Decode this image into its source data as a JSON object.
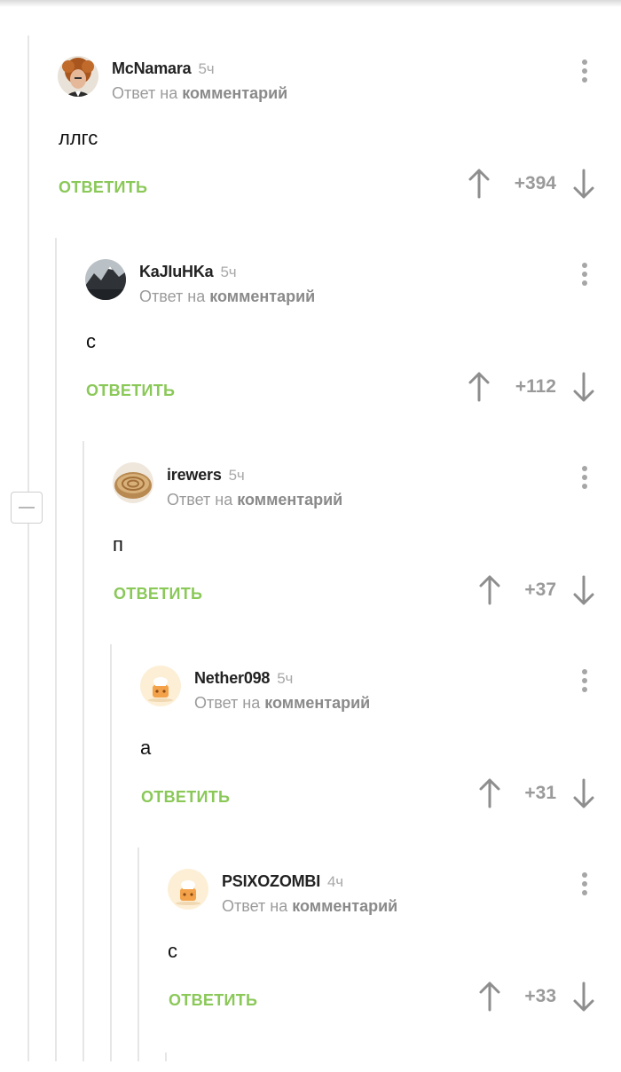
{
  "comments": [
    {
      "author": "McNamara",
      "time": "5ч",
      "reply_prefix": "Ответ на",
      "reply_link": "комментарий",
      "body": "ллгс",
      "reply_label": "ОТВЕТИТЬ",
      "score": "+394",
      "avatar_icon": "curly-hair-man-avatar"
    },
    {
      "author": "KaJIuHKa",
      "time": "5ч",
      "reply_prefix": "Ответ на",
      "reply_link": "комментарий",
      "body": "с",
      "reply_label": "ОТВЕТИТЬ",
      "score": "+112",
      "avatar_icon": "mountain-landscape-avatar"
    },
    {
      "author": "irewers",
      "time": "5ч",
      "reply_prefix": "Ответ на",
      "reply_link": "комментарий",
      "body": "п",
      "reply_label": "ОТВЕТИТЬ",
      "score": "+37",
      "avatar_icon": "pie-avatar"
    },
    {
      "author": "Nether098",
      "time": "5ч",
      "reply_prefix": "Ответ на",
      "reply_link": "комментарий",
      "body": "а",
      "reply_label": "ОТВЕТИТЬ",
      "score": "+31",
      "avatar_icon": "default-chef-avatar"
    },
    {
      "author": "PSIXOZOMBI",
      "time": "4ч",
      "reply_prefix": "Ответ на",
      "reply_link": "комментарий",
      "body": "с",
      "reply_label": "ОТВЕТИТЬ",
      "score": "+33",
      "avatar_icon": "default-chef-avatar"
    }
  ],
  "colors": {
    "accent_green": "#8ac858",
    "text_dark": "#222222",
    "text_muted": "#9b9b9b",
    "thread_line": "#e6e6e6"
  }
}
